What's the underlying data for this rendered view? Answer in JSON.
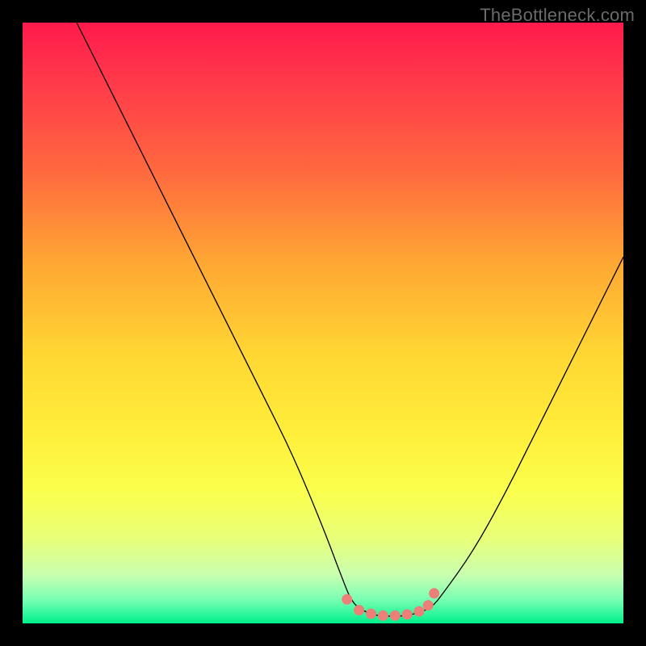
{
  "watermark": "TheBottleneck.com",
  "colors": {
    "frame_bg": "#000000",
    "curve": "#000000",
    "dots": "#ec7f78",
    "gradient_stops": [
      "#ff1a4d",
      "#ff3a4a",
      "#ff6a3f",
      "#ffa733",
      "#ffd633",
      "#ffee3a",
      "#fbff4d",
      "#e8ff7a",
      "#c8ffb0",
      "#79ffb3",
      "#00f08c"
    ]
  },
  "chart_data": {
    "type": "line",
    "title": "",
    "xlabel": "",
    "ylabel": "",
    "xlim": [
      0,
      100
    ],
    "ylim": [
      0,
      100
    ],
    "grid": false,
    "legend": false,
    "note": "Single V-shaped curve; y-axis reads as percentage (0 bottom to 100 top). Flat minimum near y≈1–2 between x≈55 and x≈68. Values estimated from pixel positions.",
    "series": [
      {
        "name": "curve",
        "x": [
          9,
          15,
          20,
          25,
          30,
          35,
          40,
          45,
          50,
          53,
          55,
          58,
          60,
          63,
          65,
          68,
          70,
          75,
          80,
          85,
          90,
          95,
          100
        ],
        "y": [
          100,
          88,
          78,
          68,
          58,
          48,
          38,
          28,
          16,
          8,
          3,
          1.5,
          1.2,
          1.2,
          1.5,
          2.5,
          5,
          12,
          21,
          31,
          41,
          51,
          61
        ]
      }
    ],
    "highlight_points": {
      "name": "flat-region-dots",
      "x": [
        54,
        56,
        58,
        60,
        62,
        64,
        66,
        67.5,
        68.5
      ],
      "y": [
        4,
        2.2,
        1.6,
        1.3,
        1.3,
        1.5,
        2.0,
        3.0,
        5.0
      ]
    }
  }
}
